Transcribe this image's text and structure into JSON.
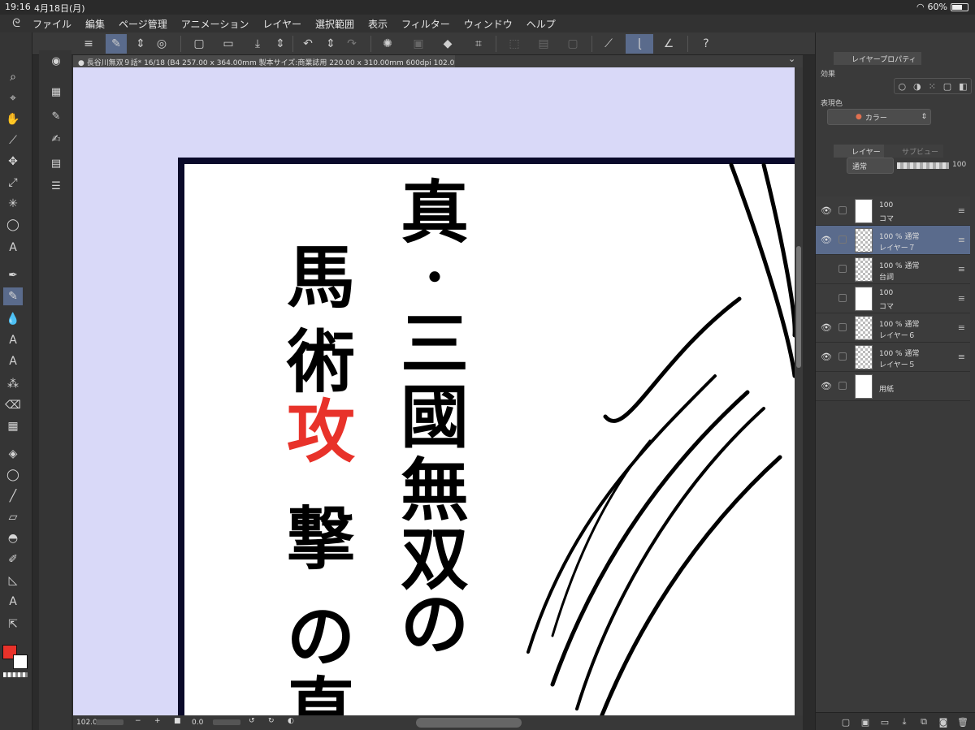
{
  "status": {
    "time": "19:16",
    "date": "4月18日(月)",
    "battery": "60%"
  },
  "menu": [
    "ファイル",
    "編集",
    "ページ管理",
    "アニメーション",
    "レイヤー",
    "選択範囲",
    "表示",
    "フィルター",
    "ウィンドウ",
    "ヘルプ"
  ],
  "document": {
    "title": "長谷川無双９話* 16/18 (B4 257.00 x 364.00mm 製本サイズ:商業誌用 220.00 x 310.00mm 600dpi 102.0%)"
  },
  "bottom": {
    "zoom": "102.0",
    "rotation": "0.0"
  },
  "canvas": {
    "lines": [
      "真・三國無双の",
      "馬術撃の直"
    ],
    "correction": "攻"
  },
  "colors": {
    "main": "#e8322a",
    "sub": "#ffffff",
    "accent": "#5a6b8c",
    "canvas_bg": "#d9d9f8"
  },
  "panel": {
    "layer_property_tab": "レイヤープロパティ",
    "effect_label": "効果",
    "color_label": "表現色",
    "color_value": "カラー",
    "layer_tab": "レイヤー",
    "sub_view_tab": "サブビュー",
    "blend_mode": "通常",
    "opacity": "100"
  },
  "layers": [
    {
      "line1": "100",
      "line2": "コマ"
    },
    {
      "line1": "100 %  通常",
      "line2": "レイヤー７"
    },
    {
      "line1": "100 %  通常",
      "line2": "台詞"
    },
    {
      "line1": "100",
      "line2": "コマ"
    },
    {
      "line1": "100 %  通常",
      "line2": "レイヤー６"
    },
    {
      "line1": "100 %  通常",
      "line2": "レイヤー５"
    },
    {
      "line1": "",
      "line2": "用紙"
    }
  ]
}
